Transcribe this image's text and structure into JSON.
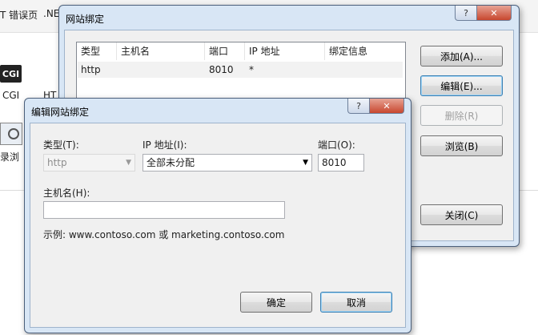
{
  "background": {
    "top_labels": [
      "T 错误页",
      ".NE"
    ],
    "cgi_badge": "CGI",
    "cgi_label": "CGI",
    "http_label": "HT",
    "log_label": "录浏"
  },
  "bindings_dialog": {
    "title": "网站绑定",
    "help_glyph": "?",
    "close_glyph": "✕",
    "columns": [
      "类型",
      "主机名",
      "端口",
      "IP 地址",
      "绑定信息"
    ],
    "rows": [
      {
        "type": "http",
        "host": "",
        "port": "8010",
        "ip": "*",
        "info": ""
      }
    ],
    "buttons": {
      "add": "添加(A)...",
      "edit": "编辑(E)...",
      "remove": "删除(R)",
      "browse": "浏览(B)",
      "close": "关闭(C)"
    }
  },
  "edit_dialog": {
    "title": "编辑网站绑定",
    "help_glyph": "?",
    "close_glyph": "✕",
    "type_label": "类型(T):",
    "type_value": "http",
    "ip_label": "IP 地址(I):",
    "ip_value": "全部未分配",
    "port_label": "端口(O):",
    "port_value": "8010",
    "host_label": "主机名(H):",
    "host_value": "",
    "example": "示例: www.contoso.com 或 marketing.contoso.com",
    "ok": "确定",
    "cancel": "取消"
  }
}
